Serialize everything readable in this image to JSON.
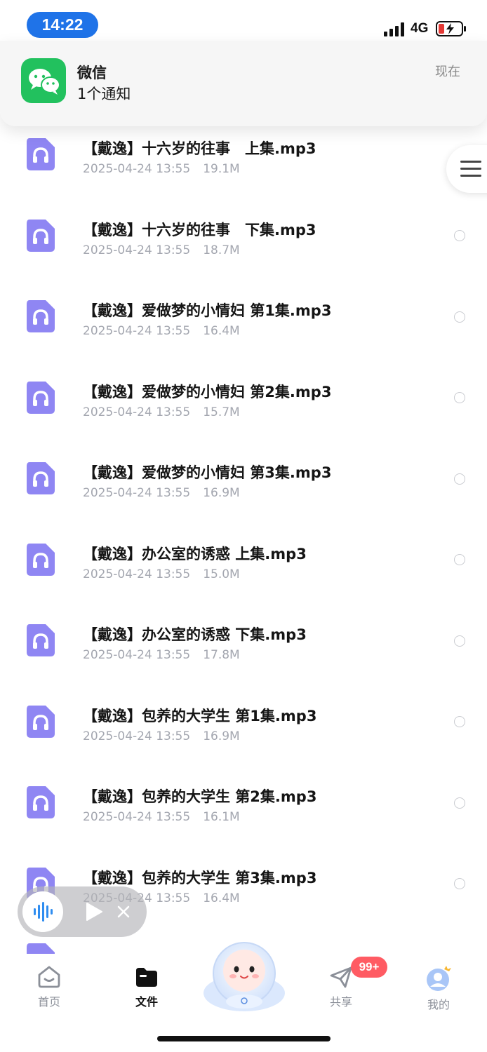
{
  "status_bar": {
    "time": "14:22",
    "network": "4G"
  },
  "notification": {
    "app": "微信",
    "body": "1个通知",
    "time": "现在"
  },
  "files": [
    {
      "name": "【戴逸】十六岁的往事　上集.mp3",
      "date": "2025-04-24 13:55",
      "size": "19.1M"
    },
    {
      "name": "【戴逸】十六岁的往事　下集.mp3",
      "date": "2025-04-24 13:55",
      "size": "18.7M"
    },
    {
      "name": "【戴逸】爱做梦的小情妇 第1集.mp3",
      "date": "2025-04-24 13:55",
      "size": "16.4M"
    },
    {
      "name": "【戴逸】爱做梦的小情妇 第2集.mp3",
      "date": "2025-04-24 13:55",
      "size": "15.7M"
    },
    {
      "name": "【戴逸】爱做梦的小情妇 第3集.mp3",
      "date": "2025-04-24 13:55",
      "size": "16.9M"
    },
    {
      "name": "【戴逸】办公室的诱惑 上集.mp3",
      "date": "2025-04-24 13:55",
      "size": "15.0M"
    },
    {
      "name": "【戴逸】办公室的诱惑 下集.mp3",
      "date": "2025-04-24 13:55",
      "size": "17.8M"
    },
    {
      "name": "【戴逸】包养的大学生 第1集.mp3",
      "date": "2025-04-24 13:55",
      "size": "16.9M"
    },
    {
      "name": "【戴逸】包养的大学生 第2集.mp3",
      "date": "2025-04-24 13:55",
      "size": "16.1M"
    },
    {
      "name": "【戴逸】包养的大学生 第3集.mp3",
      "date": "2025-04-24 13:55",
      "size": "16.4M"
    }
  ],
  "tabs": [
    {
      "label": "首页",
      "icon": "home-icon"
    },
    {
      "label": "文件",
      "icon": "folder-icon"
    },
    {
      "label": "共享",
      "icon": "send-icon"
    },
    {
      "label": "我的",
      "icon": "profile-icon"
    }
  ],
  "share_badge": "99+",
  "colors": {
    "accent": "#1f73e8",
    "file_icon": "#8f86f3",
    "badge": "#ff5b63",
    "wechat": "#22c15e"
  }
}
